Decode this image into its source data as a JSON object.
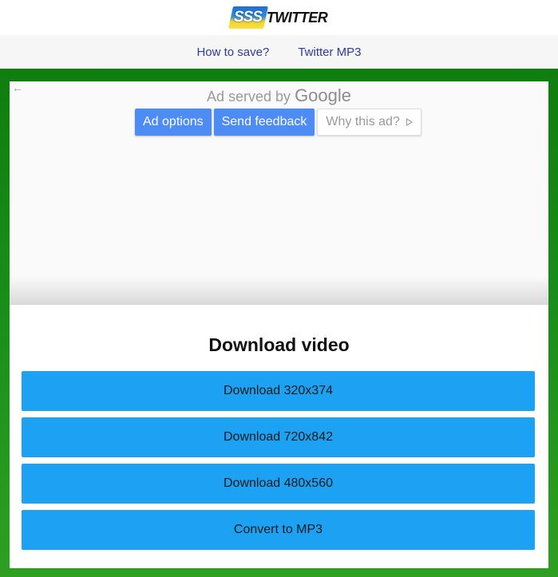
{
  "header": {
    "logo_badge": "SSS",
    "logo_text": "TWITTER"
  },
  "nav": {
    "items": [
      {
        "label": "How to save?"
      },
      {
        "label": "Twitter MP3"
      }
    ]
  },
  "ad": {
    "back_icon": "arrow-left-icon",
    "served_by": "Ad served by",
    "google": "Google",
    "ad_options_label": "Ad options",
    "send_feedback_label": "Send feedback",
    "why_this_ad_label": "Why this ad?",
    "why_icon": "adchoices-play-icon"
  },
  "panel": {
    "title": "Download video",
    "buttons": [
      {
        "label": "Download 320x374"
      },
      {
        "label": "Download 720x842"
      },
      {
        "label": "Download 480x560"
      },
      {
        "label": "Convert to MP3"
      }
    ]
  },
  "colors": {
    "frame_green": "#1a8f1a",
    "button_blue": "#1da1f2",
    "ad_button_blue": "#4d8cf5",
    "nav_link": "#2d3aa0"
  }
}
